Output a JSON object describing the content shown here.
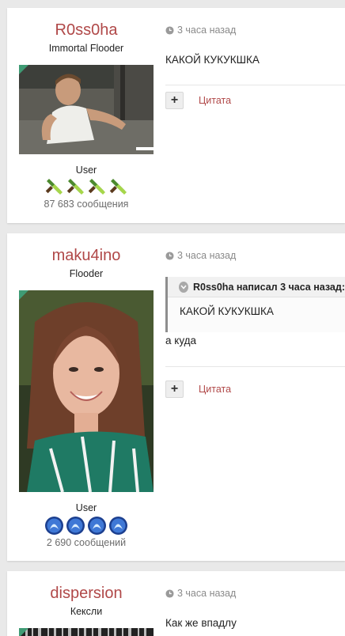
{
  "posts": [
    {
      "username": "R0ss0ha",
      "rank": "Immortal Flooder",
      "avatar": "man-in-white-tank-top-photo",
      "group": "User",
      "badge_icon": "green-dagger-icon",
      "post_count": "87 683 сообщения",
      "time": "3 часа назад",
      "text": "КАКОЙ КУКУКШКА",
      "quote_label": "Цитата"
    },
    {
      "username": "maku4ino",
      "rank": "Flooder",
      "avatar": "smiling-woman-photo",
      "group": "User",
      "badge_icon": "blue-orb-icon",
      "post_count": "2 690 сообщений",
      "time": "3 часа назад",
      "quote": {
        "header": "R0ss0ha написал 3 часа назад:",
        "text": "КАКОЙ КУКУКШКА"
      },
      "text": "а куда",
      "quote_label": "Цитата"
    },
    {
      "username": "dispersion",
      "rank": "Кексли",
      "time": "3 часа назад",
      "text": "Как же впадлу"
    }
  ],
  "colors": {
    "accent": "#b04848",
    "background": "#e9e9e9",
    "corner": "#3f9b74"
  }
}
